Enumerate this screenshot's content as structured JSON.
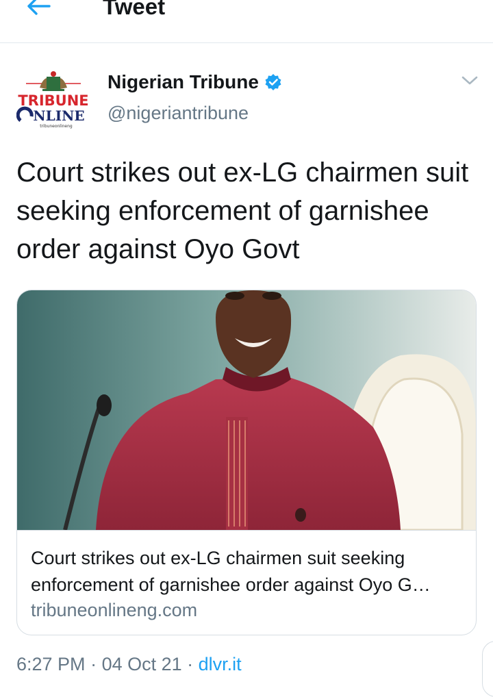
{
  "header": {
    "title": "Tweet"
  },
  "tweet": {
    "author_name": "Nigerian Tribune",
    "author_handle": "@nigeriantribune",
    "avatar": {
      "line1": "TRIBUNE",
      "line2": "NLINE",
      "line3": "tribuneonlineng"
    },
    "text": "Court strikes out ex-LG chairmen suit seeking enforcement of garnishee order against Oyo Govt",
    "card": {
      "title": "Court strikes out ex-LG chairmen suit seeking enforcement of garnishee order against Oyo G…",
      "domain": "tribuneonlineng.com"
    },
    "time": "6:27 PM",
    "date": "04 Oct 21",
    "source": "dlvr.it"
  },
  "colors": {
    "accent": "#1da1f2",
    "secondary_text": "#657786",
    "brand_red": "#d7262d",
    "brand_navy": "#1b2a6b"
  },
  "icons": {
    "back": "arrow-left-icon",
    "verified": "verified-badge-icon",
    "menu": "chevron-down-icon"
  }
}
